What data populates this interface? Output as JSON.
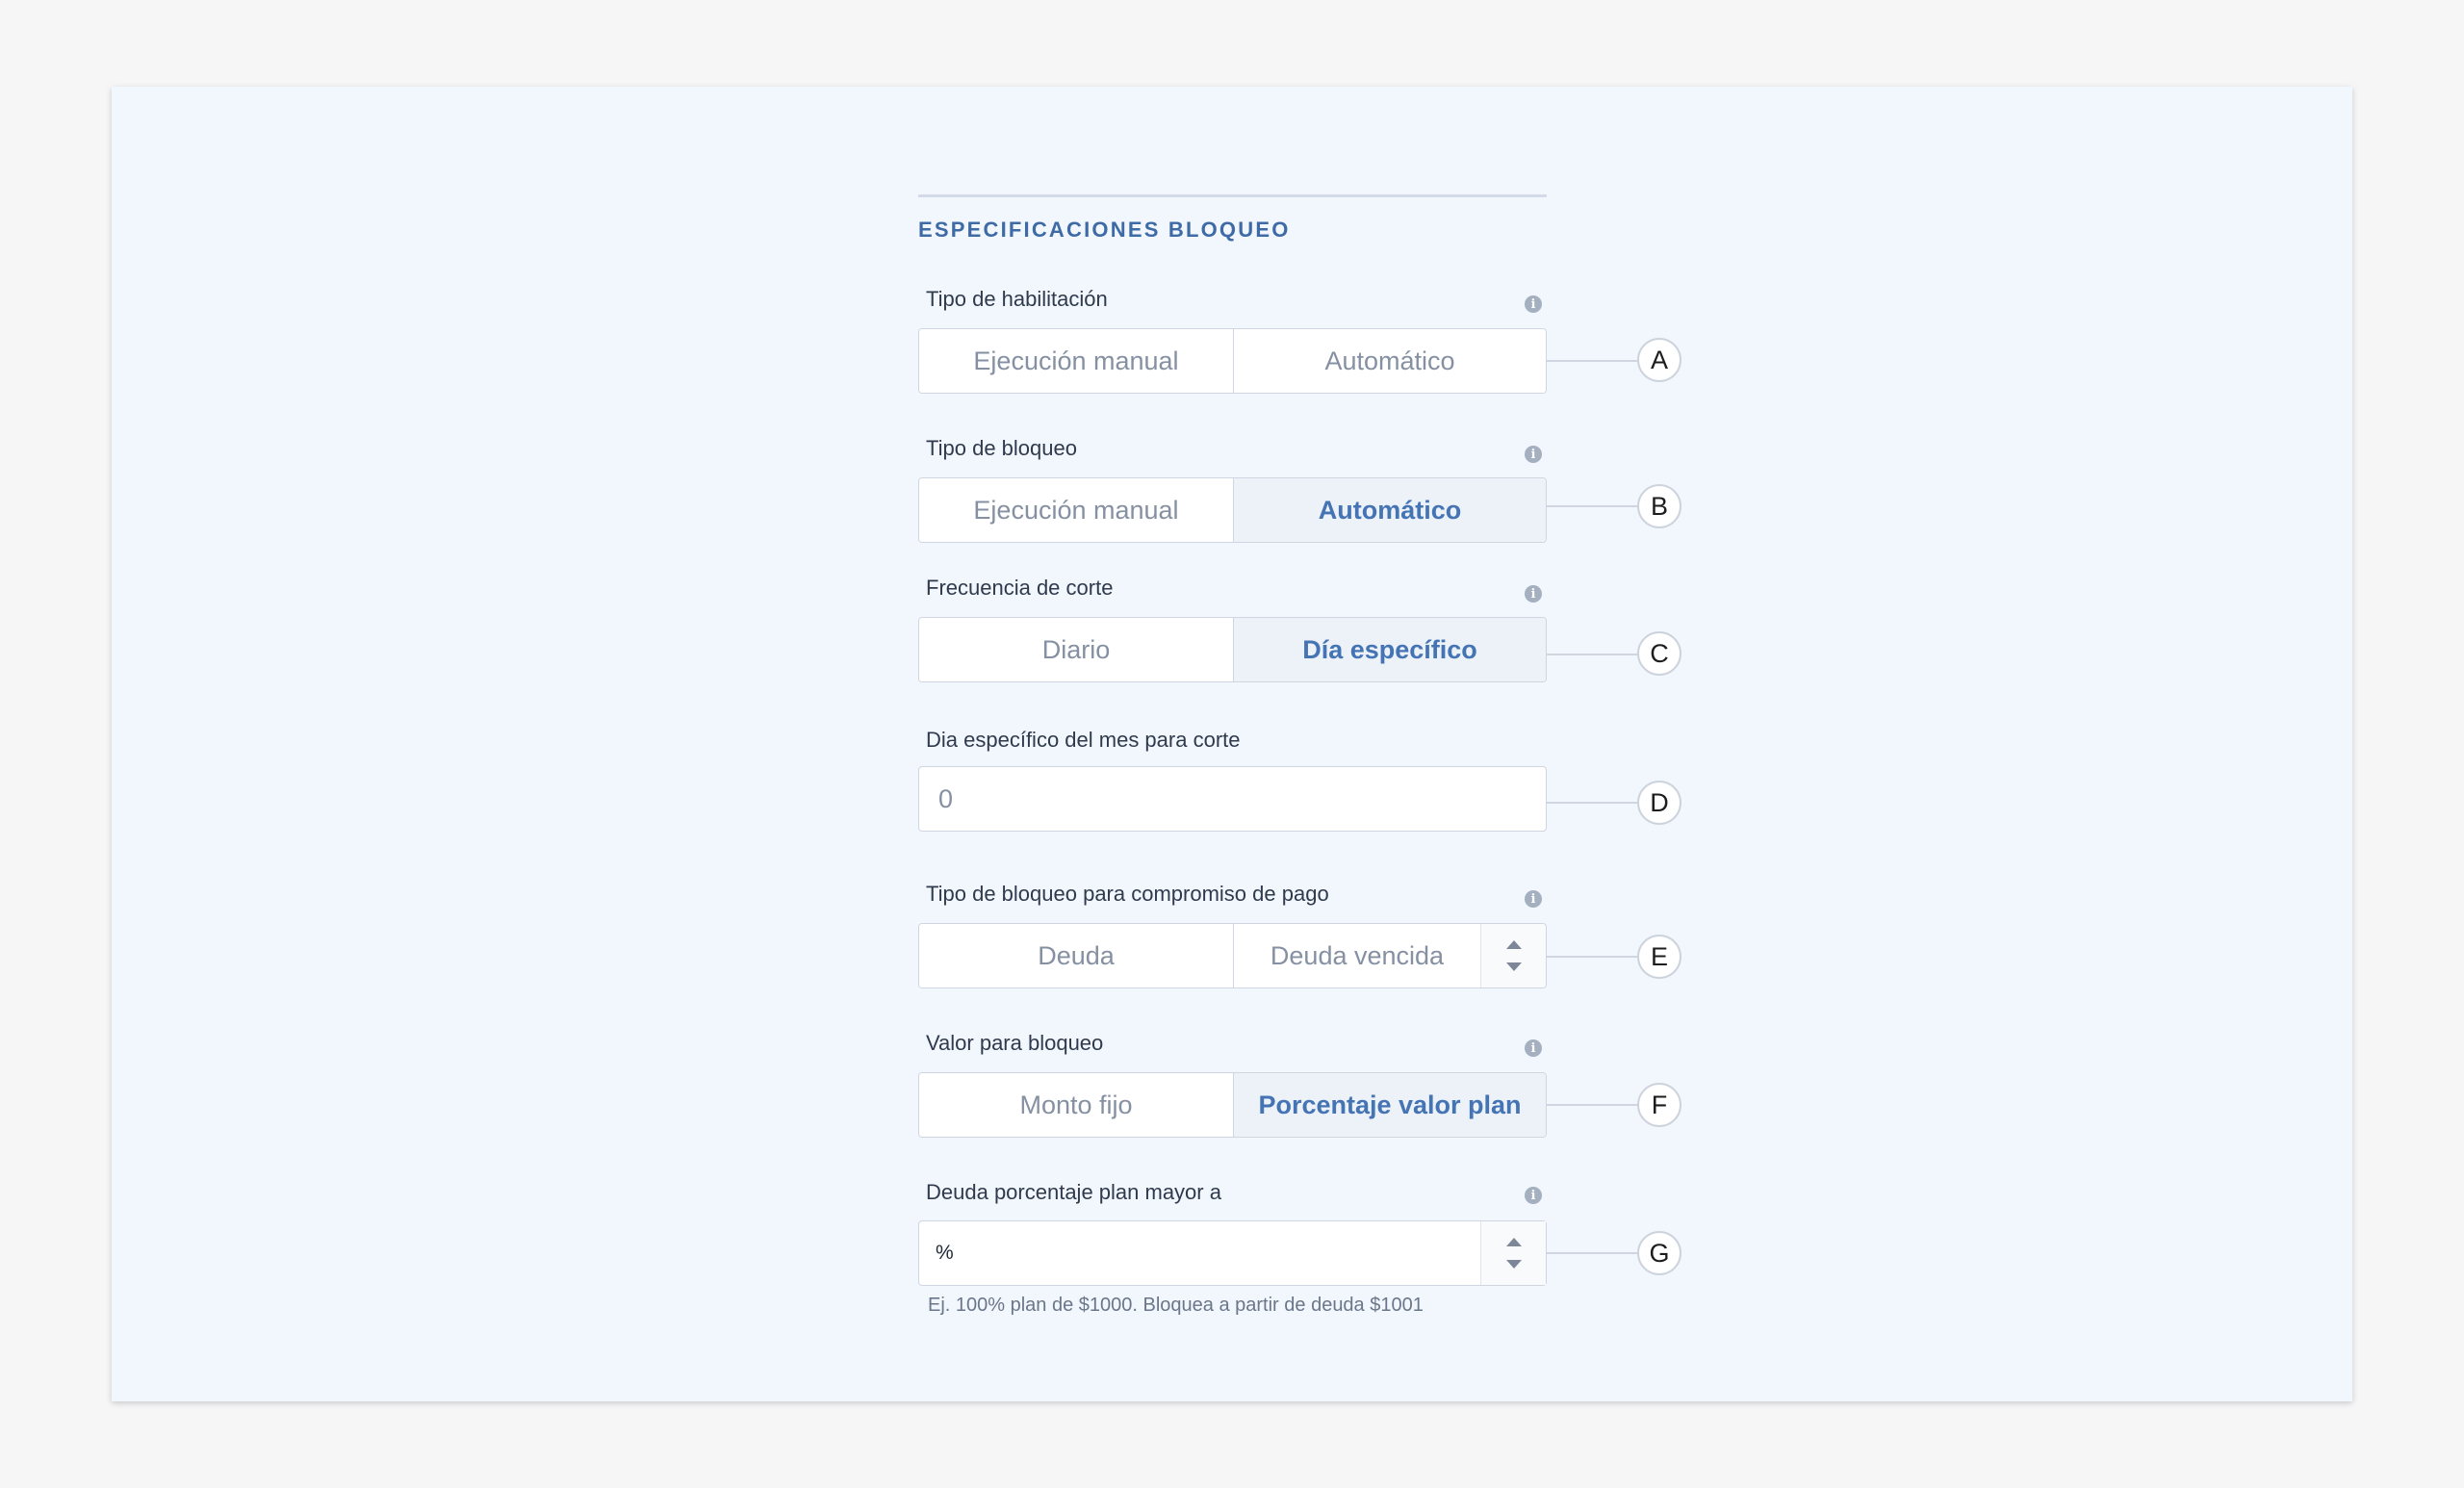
{
  "section_title": "ESPECIFICACIONES BLOQUEO",
  "info_glyph": "i",
  "fields": {
    "habilitacion": {
      "label": "Tipo de habilitación",
      "options": [
        "Ejecución manual",
        "Automático"
      ],
      "selected": null,
      "marker": "A"
    },
    "bloqueo": {
      "label": "Tipo de bloqueo",
      "options": [
        "Ejecución manual",
        "Automático"
      ],
      "selected": "Automático",
      "marker": "B"
    },
    "frecuencia": {
      "label": "Frecuencia de corte",
      "options": [
        "Diario",
        "Día específico"
      ],
      "selected": "Día específico",
      "marker": "C"
    },
    "dia": {
      "label": "Dia específico del mes para corte",
      "placeholder": "0",
      "marker": "D"
    },
    "compromiso": {
      "label": "Tipo de bloqueo para compromiso de pago",
      "options": [
        "Deuda",
        "Deuda vencida"
      ],
      "selected": null,
      "marker": "E"
    },
    "valor": {
      "label": "Valor para bloqueo",
      "options": [
        "Monto fijo",
        "Porcentaje valor plan"
      ],
      "selected": "Porcentaje valor plan",
      "marker": "F"
    },
    "porcentaje": {
      "label": "Deuda porcentaje plan mayor a",
      "value": "%",
      "help": "Ej. 100% plan de $1000. Bloquea a partir de deuda $1001",
      "marker": "G"
    }
  },
  "icons": {
    "info": "info-icon",
    "spinner_up": "caret-up-icon",
    "spinner_down": "caret-down-icon"
  },
  "colors": {
    "accent": "#4474b4",
    "section_title": "#3e6aa6",
    "panel_bg": "#f2f6fd",
    "active_option_bg": "#edf1f8"
  }
}
